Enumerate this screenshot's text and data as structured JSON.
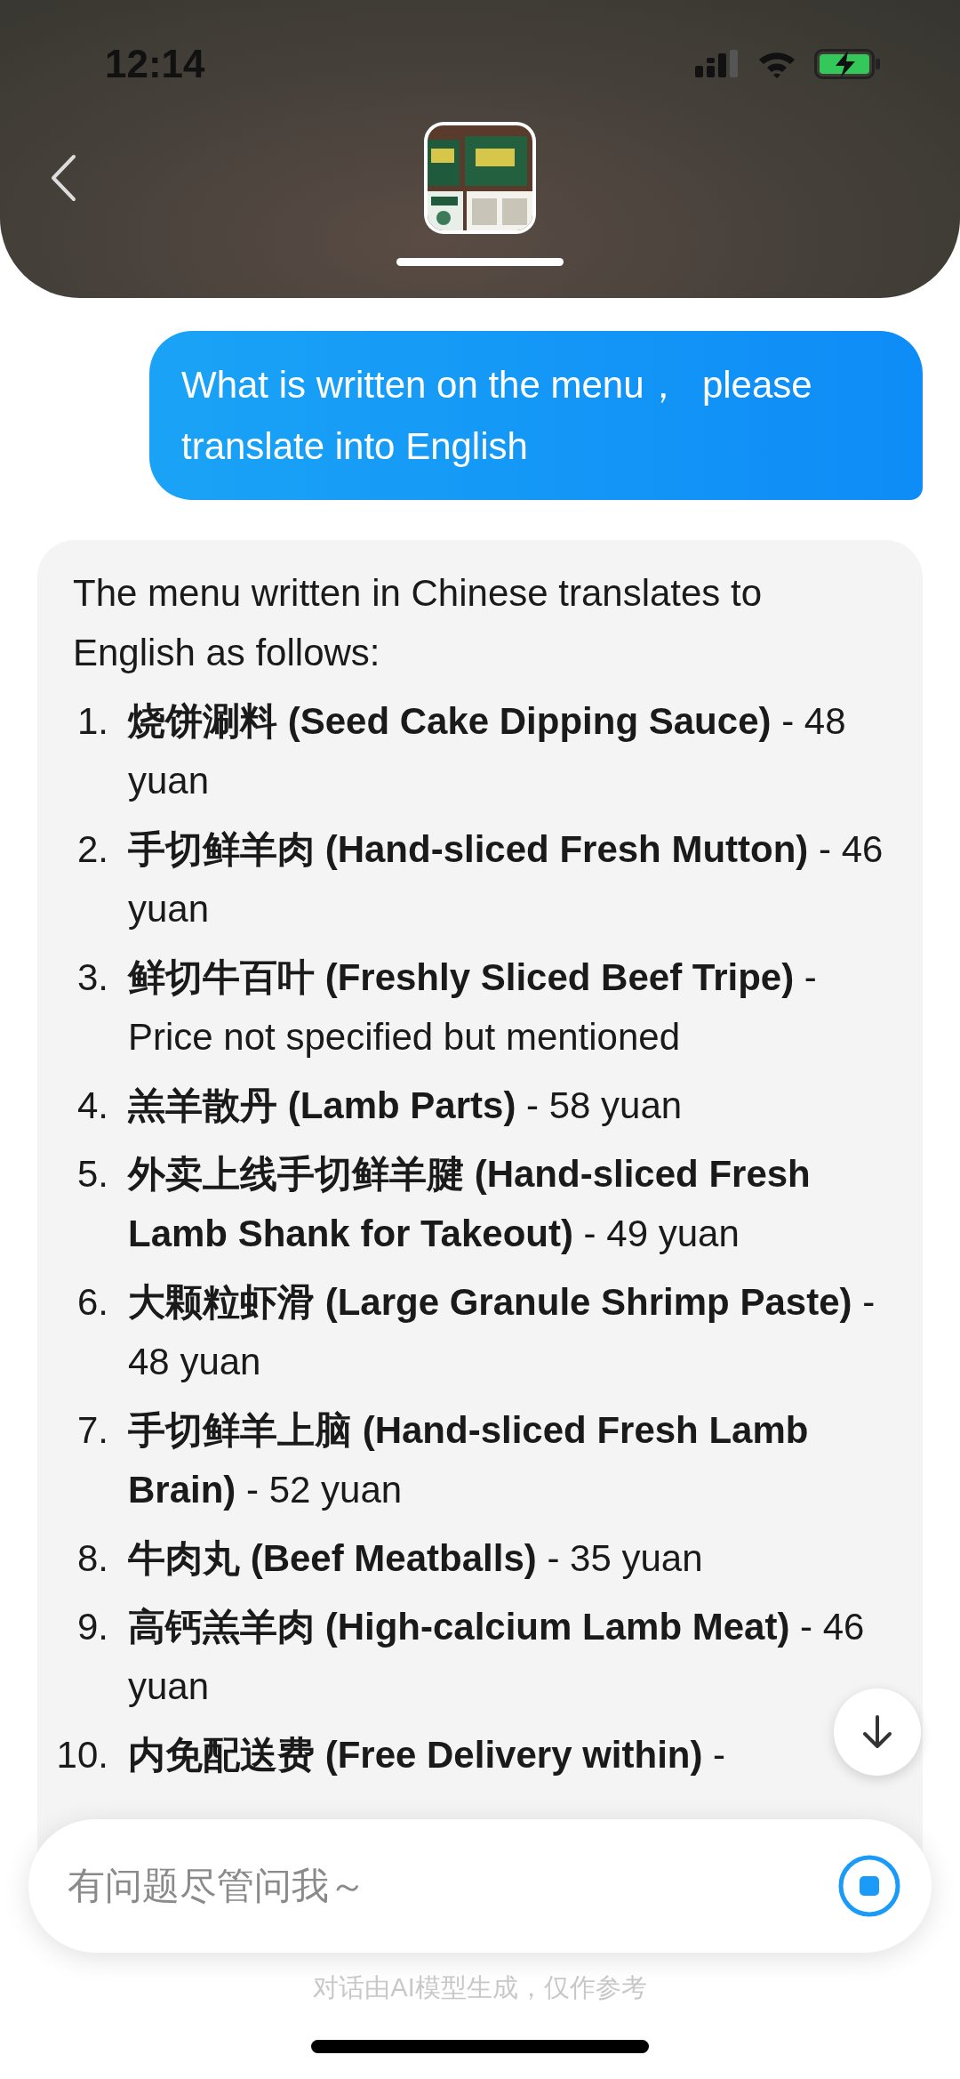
{
  "status_bar": {
    "time": "12:14"
  },
  "user_message": {
    "text": "What is written on the menu，  please translate into English"
  },
  "assistant_message": {
    "intro": "The menu written in Chinese translates to English as follows:",
    "items": [
      {
        "number": "1.",
        "text": "**烧饼涮料 (Seed Cake Dipping Sauce)** - 48 yuan"
      },
      {
        "number": "2.",
        "text": "**手切鲜羊肉 (Hand-sliced Fresh Mutton)** - 46 yuan"
      },
      {
        "number": "3.",
        "text": "**鲜切牛百叶 (Freshly Sliced Beef Tripe)** - Price not specified but mentioned"
      },
      {
        "number": "4.",
        "text": "**羔羊散丹 (Lamb Parts)** - 58 yuan"
      },
      {
        "number": "5.",
        "text": "**外卖上线手切鲜羊腱 (Hand-sliced Fresh Lamb Shank for Takeout)** - 49 yuan"
      },
      {
        "number": "6.",
        "text": "**大颗粒虾滑 (Large Granule Shrimp Paste)** - 48 yuan"
      },
      {
        "number": "7.",
        "text": "**手切鲜羊上脑 (Hand-sliced Fresh Lamb Brain)** - 52 yuan"
      },
      {
        "number": "8.",
        "text": "**牛肉丸 (Beef Meatballs)** - 35 yuan"
      },
      {
        "number": "9.",
        "text": "**高钙羔羊肉 (High-calcium Lamb Meat)** - 46 yuan"
      },
      {
        "number": "10.",
        "text": "**内免配送费 (Free Delivery within)** -"
      }
    ]
  },
  "input": {
    "placeholder": "有问题尽管问我～"
  },
  "disclaimer": "对话由AI模型生成，仅作参考"
}
